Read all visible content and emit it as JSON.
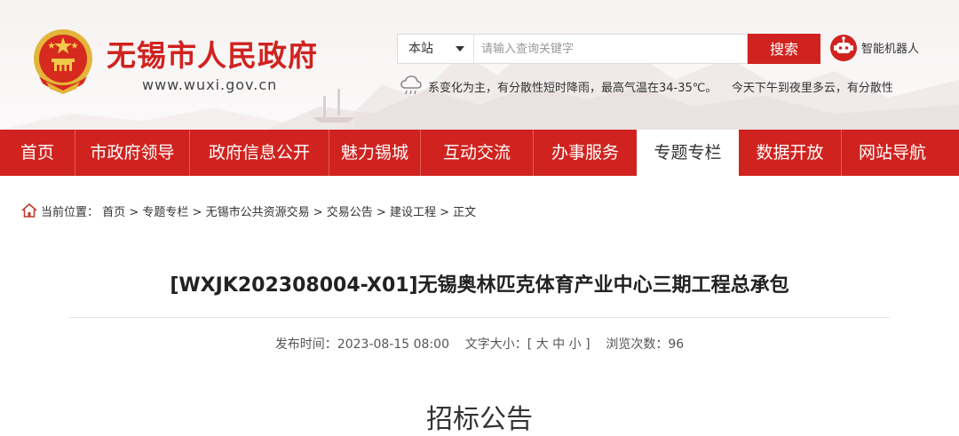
{
  "header": {
    "site_title": "无锡市人民政府",
    "site_url": "www.wuxi.gov.cn",
    "emblem_icon": "national-emblem-icon",
    "brand_color": "#d0231f"
  },
  "search": {
    "scope": "本站",
    "placeholder": "请输入查询关键字",
    "button_label": "搜索"
  },
  "robot": {
    "icon": "robot-icon",
    "label": "智能机器人"
  },
  "weather": {
    "icon": "weather-cloud-rain-icon",
    "text": "系变化为主，有分散性短时降雨，最高气温在34-35℃。    今天下午到夜里多云，有分散性"
  },
  "nav": {
    "items": [
      {
        "label": "首页",
        "active": false
      },
      {
        "label": "市政府领导",
        "active": false
      },
      {
        "label": "政府信息公开",
        "active": false
      },
      {
        "label": "魅力锡城",
        "active": false
      },
      {
        "label": "互动交流",
        "active": false
      },
      {
        "label": "办事服务",
        "active": false
      },
      {
        "label": "专题专栏",
        "active": true
      },
      {
        "label": "数据开放",
        "active": false
      },
      {
        "label": "网站导航",
        "active": false
      }
    ]
  },
  "breadcrumb": {
    "icon": "home-icon",
    "prefix": "当前位置：",
    "items": [
      "首页",
      "专题专栏",
      "无锡市公共资源交易",
      "交易公告",
      "建设工程",
      "正文"
    ],
    "separator": ">"
  },
  "article": {
    "title": "[WXJK202308004-X01]无锡奥林匹克体育产业中心三期工程总承包",
    "publish_label": "发布时间：",
    "publish_time": "2023-08-15 08:00",
    "font_size_label": "文字大小：",
    "font_size_open": "[",
    "font_size_large": "大",
    "font_size_medium": "中",
    "font_size_small": "小",
    "font_size_close": "]",
    "views_label": "浏览次数：",
    "views": "96",
    "notice_heading": "招标公告"
  }
}
